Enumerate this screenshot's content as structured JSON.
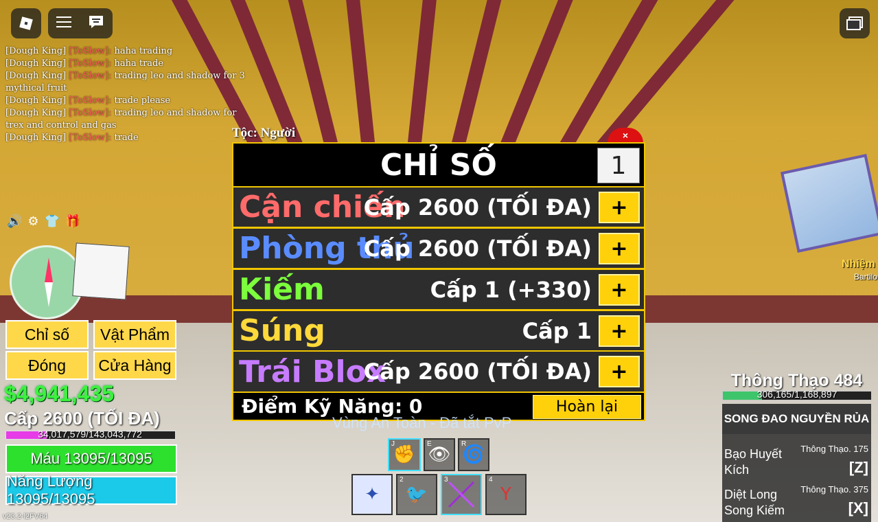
{
  "top_bar": {
    "roblox_icon": "roblox-logo-icon",
    "menu_icon": "hamburger-menu-icon",
    "chat_icon": "chat-icon",
    "inventory_icon": "window-stack-icon"
  },
  "chat": {
    "messages": [
      {
        "name": "[Dough King]",
        "tag": "[ToSlow]:",
        "text": "haha trading"
      },
      {
        "name": "[Dough King]",
        "tag": "[ToSlow]:",
        "text": "haha trade"
      },
      {
        "name": "[Dough King]",
        "tag": "[ToSlow]:",
        "text": "trading leo and shadow for 3 mythical fruit"
      },
      {
        "name": "[Dough King]",
        "tag": "[ToSlow]:",
        "text": "trade please"
      },
      {
        "name": "[Dough King]",
        "tag": "[ToSlow]:",
        "text": "trading leo and shadow for trex and control and gas"
      },
      {
        "name": "[Dough King]",
        "tag": "[ToSlow]:",
        "text": "trade"
      }
    ]
  },
  "left_menu": {
    "stats": "Chỉ số",
    "items": "Vật Phẩm",
    "close": "Đóng",
    "shop": "Cửa Hàng"
  },
  "player": {
    "money": "$4,941,435",
    "level": "Cấp 2600 (TỐI ĐA)",
    "xp_text": "34,017,579/143,043,772",
    "xp_fraction": 0.238,
    "health_text": "Máu 13095/13095",
    "health_fraction": 1.0,
    "energy_text": "Năng Lượng 13095/13095",
    "energy_fraction": 1.0,
    "version": "v23.2-l2FV64"
  },
  "stats_panel": {
    "race": "Tộc: Người",
    "close": "×",
    "title": "CHỈ SỐ",
    "amount": "1",
    "rows": [
      {
        "name": "Cận chiến",
        "level": "Cấp 2600 (TỐI ĐA)",
        "color": "#ff6b6b",
        "plus": "+"
      },
      {
        "name": "Phòng thủ",
        "level": "Cấp 2600 (TỐI ĐA)",
        "color": "#5a8cff",
        "plus": "+"
      },
      {
        "name": "Kiếm",
        "level": "Cấp 1 (+330)",
        "color": "#7cff3c",
        "plus": "+"
      },
      {
        "name": "Súng",
        "level": "Cấp 1",
        "color": "#ffd93a",
        "plus": "+"
      },
      {
        "name": "Trái Blox",
        "level": "Cấp 2600 (TỐI ĐA)",
        "color": "#c77cff",
        "plus": "+"
      }
    ],
    "points": "Điểm Kỹ Năng: 0",
    "reset": "Hoàn lại"
  },
  "zone": "Vùng An Toàn - Đã tắt PvP",
  "abilities": [
    {
      "key": "J",
      "icon": "fist-icon"
    },
    {
      "key": "E",
      "icon": "eye-icon"
    },
    {
      "key": "R",
      "icon": "spiral-icon"
    }
  ],
  "hotbar": [
    {
      "key": "1",
      "icon": "fighting-style-icon"
    },
    {
      "key": "2",
      "icon": "fruit-icon"
    },
    {
      "key": "3",
      "icon": "dual-swords-icon"
    },
    {
      "key": "4",
      "icon": "slingshot-icon"
    }
  ],
  "weapon": {
    "mastery": "Thông Thạo 484",
    "mastery_text": "306,165/1,168,897",
    "mastery_fraction": 0.262,
    "name": "SONG ĐAO NGUYỀN RỦA",
    "skills": [
      {
        "name": "Bạo Huyết Kích",
        "mastery": "Thông Thạo. 175",
        "key": "[Z]"
      },
      {
        "name": "Diệt Long Song Kiếm",
        "mastery": "Thông Thạo. 375",
        "key": "[X]"
      }
    ]
  },
  "world": {
    "quest_label": "Nhiệm",
    "npc_label": "Bartilo"
  }
}
